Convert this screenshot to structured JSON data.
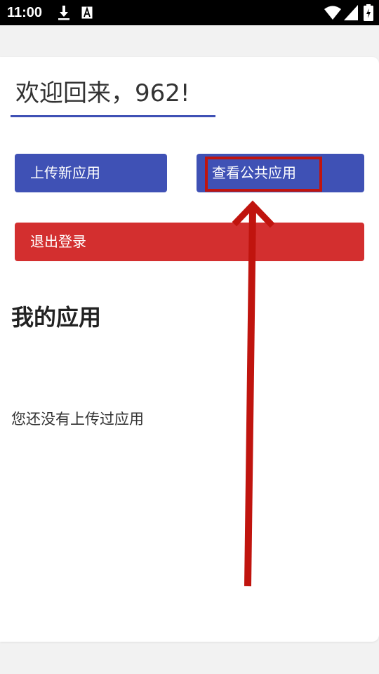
{
  "status_bar": {
    "time": "11:00",
    "icons": [
      "download-icon",
      "a-icon",
      "wifi-icon",
      "signal-icon",
      "battery-icon"
    ]
  },
  "main": {
    "welcome_text": "欢迎回来，962!",
    "buttons": {
      "upload_label": "上传新应用",
      "public_label": "查看公共应用",
      "logout_label": "退出登录"
    },
    "section_title": "我的应用",
    "empty_message": "您还没有上传过应用"
  },
  "colors": {
    "primary": "#3f51b5",
    "danger": "#d32f2f",
    "annotation": "#c0140e"
  }
}
